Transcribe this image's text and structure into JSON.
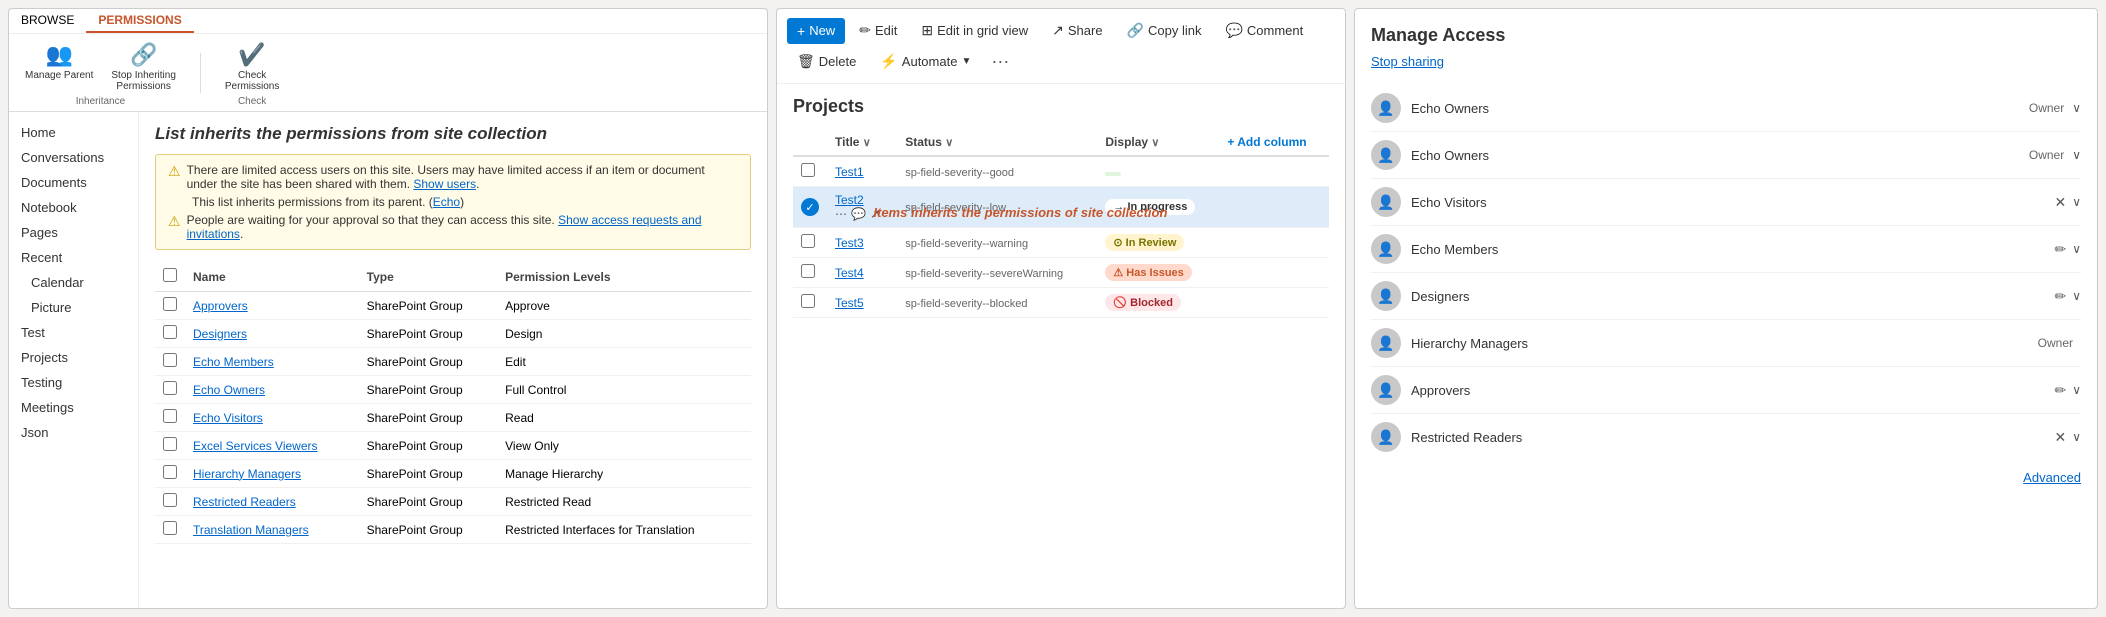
{
  "left": {
    "ribbon": {
      "tabs": [
        {
          "label": "BROWSE",
          "active": false
        },
        {
          "label": "PERMISSIONS",
          "active": true
        }
      ],
      "groups": [
        {
          "name": "Inheritance",
          "buttons": [
            {
              "id": "manage-parent",
              "label": "Manage\nParent",
              "icon": "👥"
            },
            {
              "id": "stop-inheriting",
              "label": "Stop Inheriting\nPermissions",
              "icon": "🔗"
            }
          ]
        },
        {
          "name": "Check",
          "buttons": [
            {
              "id": "check-permissions",
              "label": "Check\nPermissions",
              "icon": "✔️"
            }
          ]
        }
      ]
    },
    "page_title": "List inherits the permissions from site collection",
    "warning": {
      "lines": [
        "There are limited access users on this site. Users may have limited access if an item or document under the site has been shared with them. Show users.",
        "This list inherits permissions from its parent. (Echo)",
        "People are waiting for your approval so that they can access this site. Show access requests and invitations."
      ]
    },
    "sidebar": {
      "items": [
        {
          "label": "Home",
          "level": 0
        },
        {
          "label": "Conversations",
          "level": 0
        },
        {
          "label": "Documents",
          "level": 0
        },
        {
          "label": "Notebook",
          "level": 0
        },
        {
          "label": "Pages",
          "level": 0
        },
        {
          "label": "Recent",
          "level": 0
        },
        {
          "label": "Calendar",
          "level": 1
        },
        {
          "label": "Picture",
          "level": 1
        },
        {
          "label": "Test",
          "level": 0
        },
        {
          "label": "Projects",
          "level": 0
        },
        {
          "label": "Testing",
          "level": 0
        },
        {
          "label": "Meetings",
          "level": 0
        },
        {
          "label": "Json",
          "level": 0
        }
      ]
    },
    "table": {
      "headers": [
        "Name",
        "Type",
        "Permission Levels"
      ],
      "rows": [
        {
          "name": "Approvers",
          "type": "SharePoint Group",
          "level": "Approve"
        },
        {
          "name": "Designers",
          "type": "SharePoint Group",
          "level": "Design"
        },
        {
          "name": "Echo Members",
          "type": "SharePoint Group",
          "level": "Edit"
        },
        {
          "name": "Echo Owners",
          "type": "SharePoint Group",
          "level": "Full Control"
        },
        {
          "name": "Echo Visitors",
          "type": "SharePoint Group",
          "level": "Read"
        },
        {
          "name": "Excel Services Viewers",
          "type": "SharePoint Group",
          "level": "View Only"
        },
        {
          "name": "Hierarchy Managers",
          "type": "SharePoint Group",
          "level": "Manage Hierarchy"
        },
        {
          "name": "Restricted Readers",
          "type": "SharePoint Group",
          "level": "Restricted Read"
        },
        {
          "name": "Translation Managers",
          "type": "SharePoint Group",
          "level": "Restricted Interfaces for Translation"
        }
      ]
    }
  },
  "middle": {
    "toolbar": {
      "buttons": [
        {
          "id": "new-btn",
          "label": "New",
          "primary": true,
          "icon": "+"
        },
        {
          "id": "edit-btn",
          "label": "Edit",
          "icon": "✏️"
        },
        {
          "id": "edit-grid-btn",
          "label": "Edit in grid view",
          "icon": "⊞"
        },
        {
          "id": "share-btn",
          "label": "Share",
          "icon": "↗"
        },
        {
          "id": "copy-link-btn",
          "label": "Copy link",
          "icon": "🔗"
        },
        {
          "id": "comment-btn",
          "label": "Comment",
          "icon": "💬"
        },
        {
          "id": "delete-btn",
          "label": "Delete",
          "icon": "🗑"
        },
        {
          "id": "automate-btn",
          "label": "Automate",
          "icon": "⚡"
        }
      ],
      "more": "..."
    },
    "list_title": "Projects",
    "inherit_message": "Items inherits the permissions of site collection",
    "table": {
      "headers": [
        {
          "label": "Title",
          "sortable": true
        },
        {
          "label": "Status",
          "sortable": true
        },
        {
          "label": "Display",
          "sortable": true
        },
        {
          "label": "+ Add column",
          "add": true
        }
      ],
      "rows": [
        {
          "id": "Test1",
          "status_field": "sp-field-severity--good",
          "display": "",
          "status_class": "status-good",
          "status_label": ""
        },
        {
          "id": "Test2",
          "status_field": "sp-field-severity--low",
          "display": "→ In progress",
          "status_class": "status-low",
          "selected": true
        },
        {
          "id": "Test3",
          "status_field": "sp-field-severity--warning",
          "display": "⊙ In Review",
          "status_class": "status-warning"
        },
        {
          "id": "Test4",
          "status_field": "sp-field-severity--severeWarning",
          "display": "⚠ Has Issues",
          "status_class": "status-severe"
        },
        {
          "id": "Test5",
          "status_field": "sp-field-severity--blocked",
          "display": "🚫 Blocked",
          "status_class": "status-blocked"
        }
      ]
    }
  },
  "right": {
    "title": "Manage Access",
    "stop_sharing": "Stop sharing",
    "items": [
      {
        "name": "Echo Owners",
        "role": "Owner",
        "editable": false,
        "deletable": false
      },
      {
        "name": "Echo Owners",
        "role": "Owner",
        "editable": false,
        "deletable": false
      },
      {
        "name": "Echo Visitors",
        "role": "",
        "editable": false,
        "deletable": true,
        "expandable": true
      },
      {
        "name": "Echo Members",
        "role": "",
        "editable": true,
        "deletable": false,
        "expandable": true
      },
      {
        "name": "Designers",
        "role": "",
        "editable": true,
        "deletable": false,
        "expandable": true
      },
      {
        "name": "Hierarchy Managers",
        "role": "Owner",
        "editable": false,
        "deletable": false,
        "expandable": false
      },
      {
        "name": "Approvers",
        "role": "",
        "editable": true,
        "deletable": false,
        "expandable": true
      },
      {
        "name": "Restricted Readers",
        "role": "",
        "editable": false,
        "deletable": true,
        "expandable": true
      }
    ],
    "advanced_label": "Advanced"
  }
}
